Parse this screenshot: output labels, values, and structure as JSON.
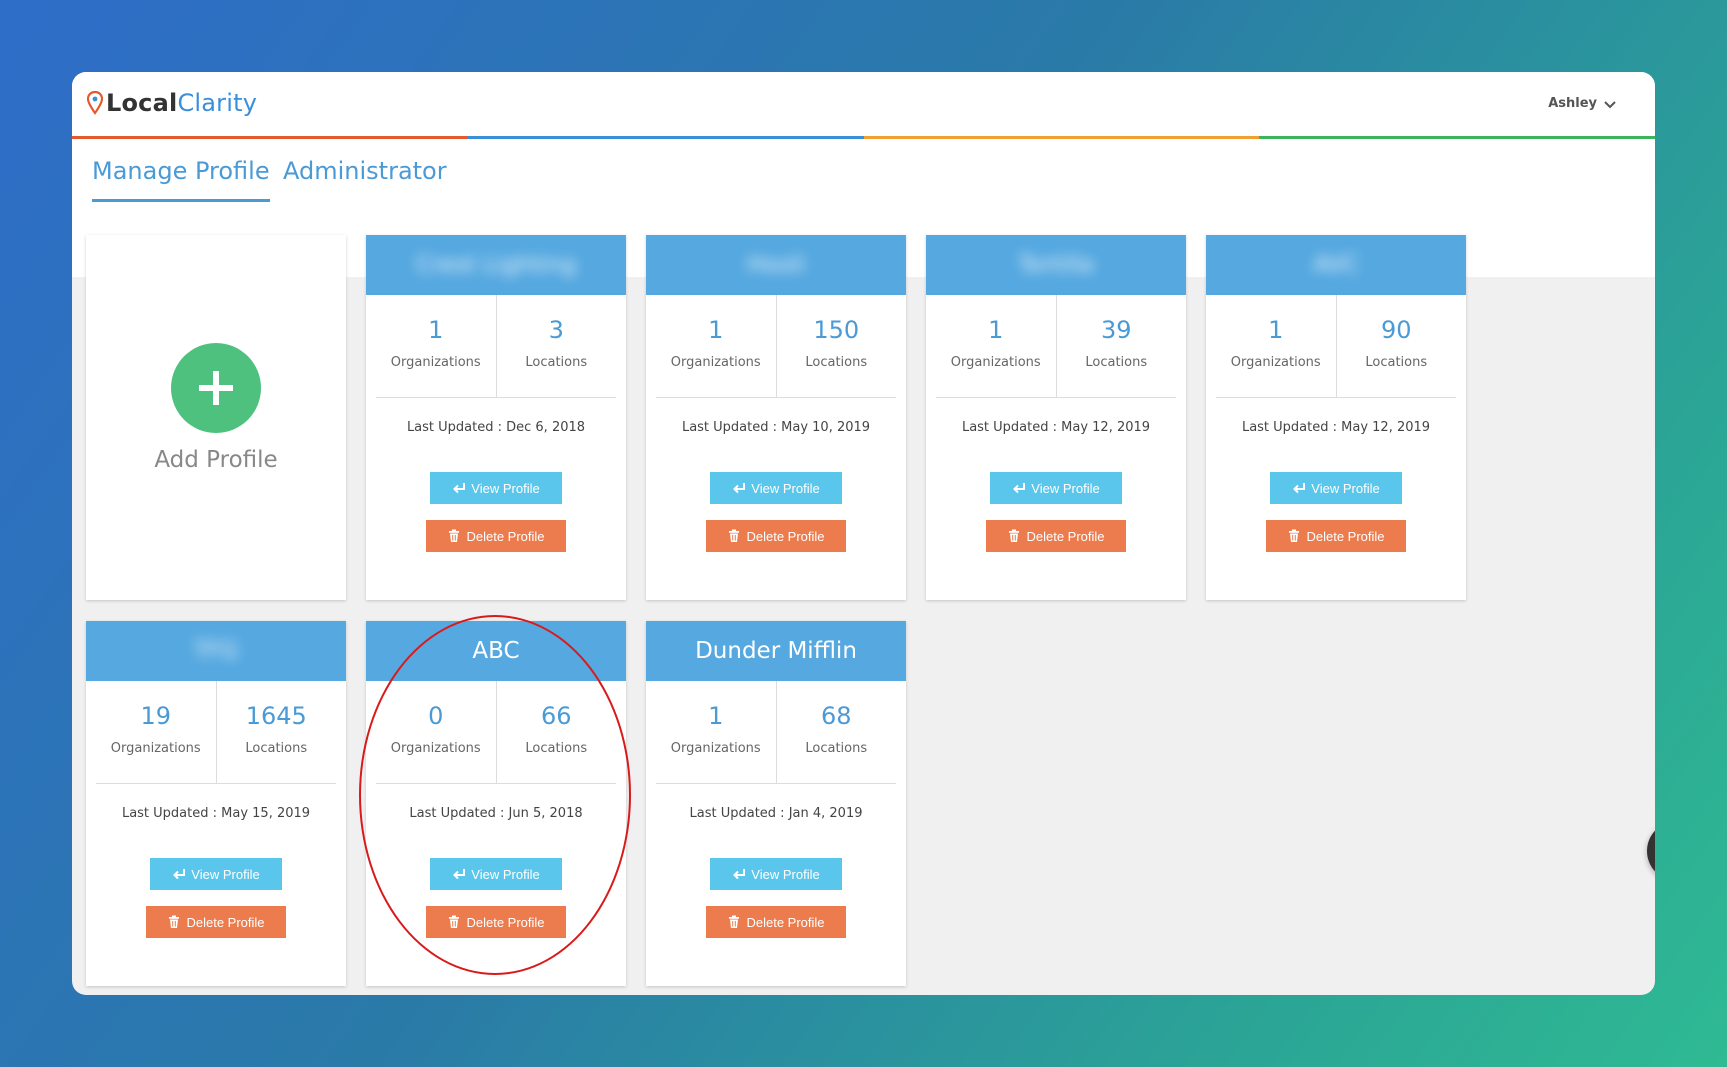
{
  "header": {
    "logo_local": "Local",
    "logo_clarity": "Clarity",
    "user_name": "Ashley",
    "rainbow_colors": [
      "#e55a2b",
      "#3a8fd9",
      "#f0a030",
      "#3cb55a"
    ]
  },
  "tabs": [
    {
      "label": "Manage Profile",
      "active": true
    },
    {
      "label": "Administrator",
      "active": false
    }
  ],
  "add_card": {
    "label": "Add Profile"
  },
  "labels": {
    "organizations": "Organizations",
    "locations": "Locations",
    "view_button": "View Profile",
    "delete_button": "Delete Profile"
  },
  "profiles": [
    {
      "name": "Crest Lighting",
      "blurred": true,
      "organizations": "1",
      "locations": "3",
      "last_updated": "Last Updated : Dec 6, 2018"
    },
    {
      "name": "Hooli",
      "blurred": true,
      "organizations": "1",
      "locations": "150",
      "last_updated": "Last Updated : May 10, 2019"
    },
    {
      "name": "Tortilla",
      "blurred": true,
      "organizations": "1",
      "locations": "39",
      "last_updated": "Last Updated : May 12, 2019"
    },
    {
      "name": "AVC",
      "blurred": true,
      "organizations": "1",
      "locations": "90",
      "last_updated": "Last Updated : May 12, 2019"
    },
    {
      "name": "TFG",
      "blurred": true,
      "organizations": "19",
      "locations": "1645",
      "last_updated": "Last Updated : May 15, 2019"
    },
    {
      "name": "ABC",
      "blurred": false,
      "organizations": "0",
      "locations": "66",
      "last_updated": "Last Updated : Jun 5, 2018"
    },
    {
      "name": "Dunder Mifflin",
      "blurred": false,
      "organizations": "1",
      "locations": "68",
      "last_updated": "Last Updated : Jan 4, 2019"
    }
  ],
  "colors": {
    "header_blue": "#55a8e0",
    "view_button": "#5bc6ec",
    "delete_button": "#ec7c4d",
    "add_green": "#4fc17f",
    "annotation_red": "#d91a1a"
  }
}
